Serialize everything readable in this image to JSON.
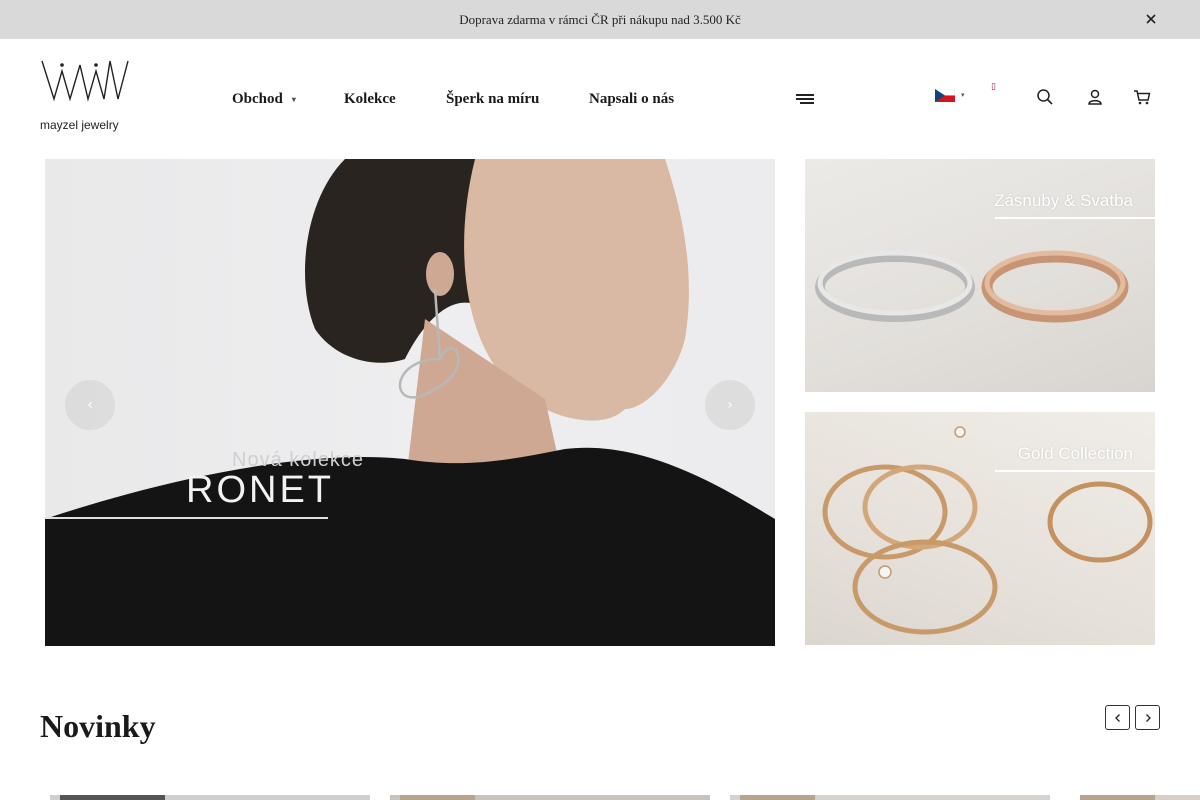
{
  "announcement": {
    "text": "Doprava zdarma v rámci ČR při nákupu nad 3.500 Kč",
    "close_icon": "close-icon"
  },
  "header": {
    "logo_text": "mayzel jewelry",
    "nav": [
      {
        "label": "Obchod",
        "has_dropdown": true
      },
      {
        "label": "Kolekce"
      },
      {
        "label": "Šperk na míru"
      },
      {
        "label": "Napsali o nás"
      }
    ],
    "icons": [
      "menu-icon",
      "czech-flag-icon",
      "search-icon",
      "user-icon",
      "cart-icon"
    ]
  },
  "hero": {
    "subtitle": "Nová kolekce",
    "title": "RONET"
  },
  "side_cards": [
    {
      "label": "Zásnuby & Svatba"
    },
    {
      "label": "Gold Collection"
    }
  ],
  "novinky": {
    "title": "Novinky"
  },
  "colors": {
    "accent_red": "#c2185b",
    "announce_bg": "#d9d9d9"
  }
}
